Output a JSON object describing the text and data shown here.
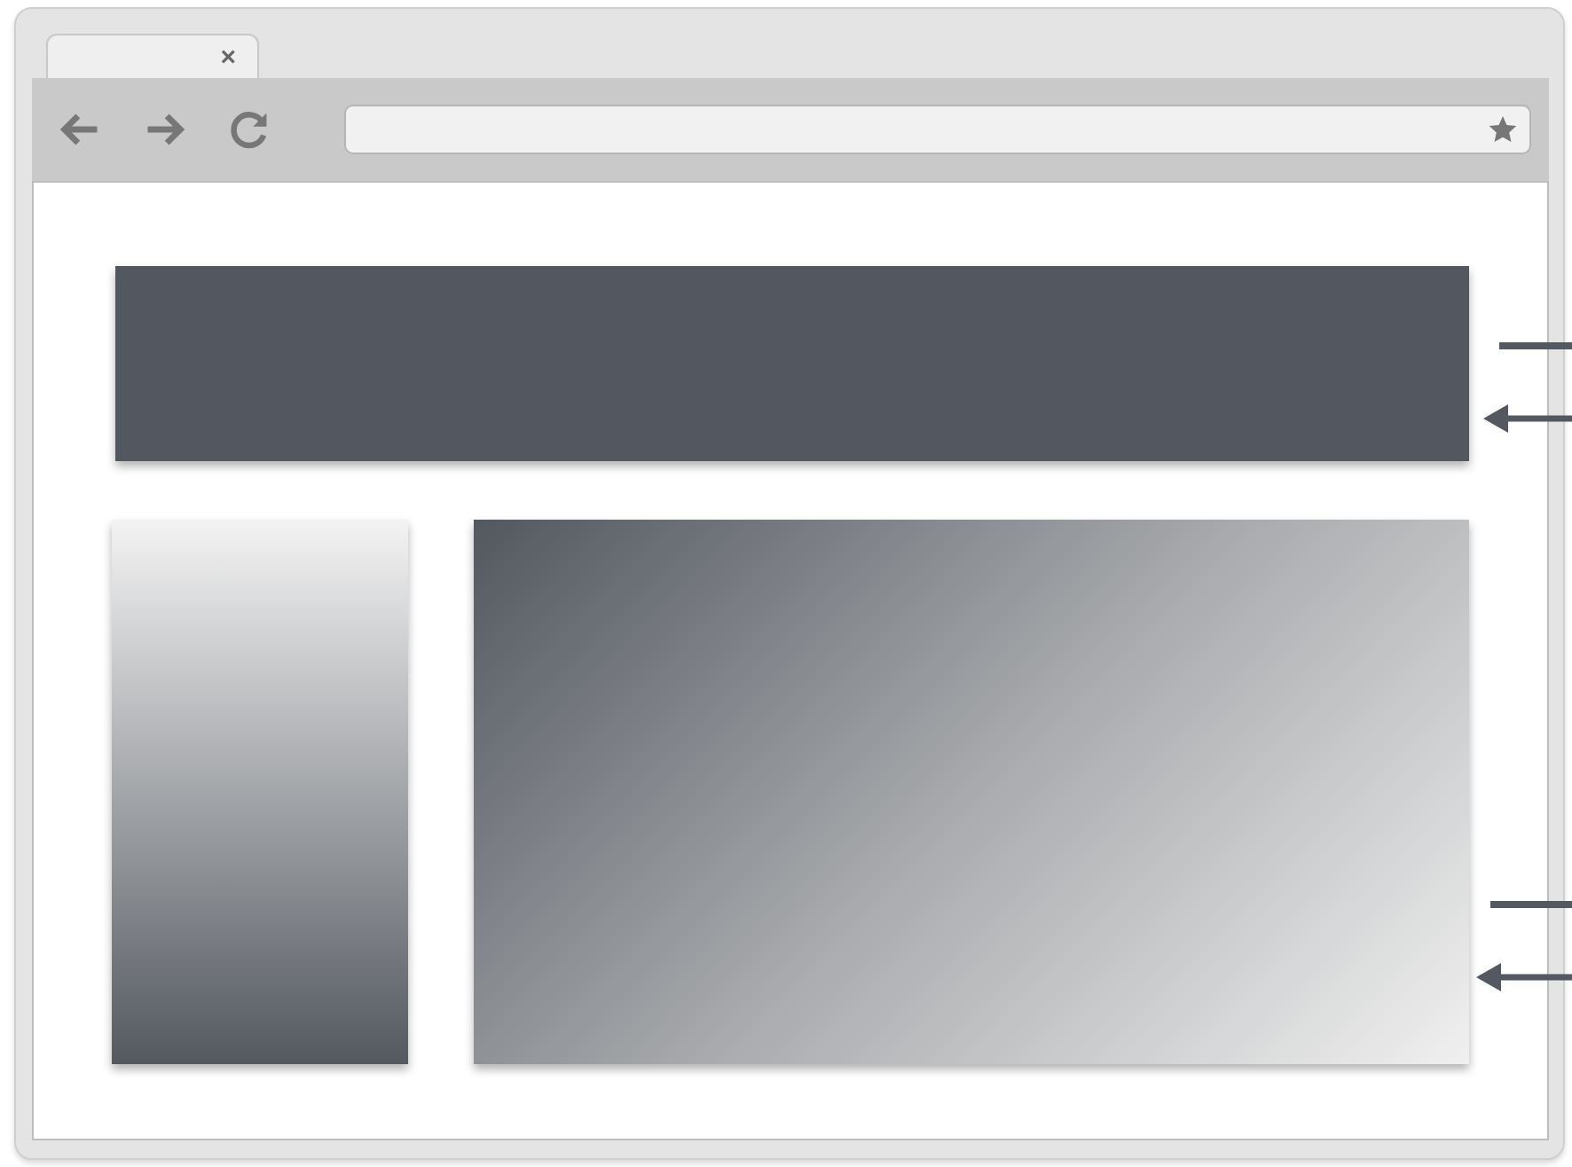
{
  "tab": {
    "close": "×"
  }
}
